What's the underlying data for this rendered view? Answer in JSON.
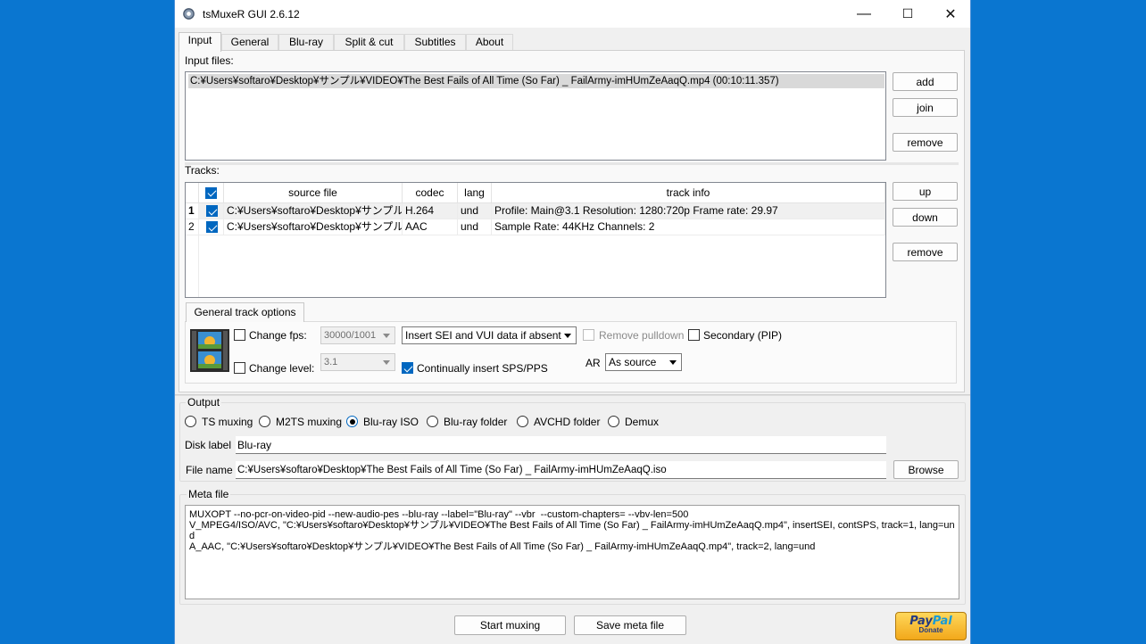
{
  "window": {
    "title": "tsMuxeR GUI 2.6.12",
    "minimize": "—",
    "maximize": "☐",
    "close": "✕"
  },
  "tabs": [
    "Input",
    "General",
    "Blu-ray",
    "Split & cut",
    "Subtitles",
    "About"
  ],
  "input": {
    "files_label": "Input files:",
    "files": [
      "C:¥Users¥softaro¥Desktop¥サンプル¥VIDEO¥The Best Fails of All Time (So Far) _ FailArmy-imHUmZeAaqQ.mp4 (00:10:11.357)"
    ],
    "add": "add",
    "join": "join",
    "remove": "remove"
  },
  "tracks": {
    "label": "Tracks:",
    "headers": {
      "source": "source file",
      "codec": "codec",
      "lang": "lang",
      "info": "track info"
    },
    "rows": [
      {
        "num": "1",
        "source": "C:¥Users¥softaro¥Desktop¥サンプル¥...",
        "codec": "H.264",
        "lang": "und",
        "info": "Profile: Main@3.1  Resolution: 1280:720p  Frame rate: 29.97"
      },
      {
        "num": "2",
        "source": "C:¥Users¥softaro¥Desktop¥サンプル¥...",
        "codec": "AAC",
        "lang": "und",
        "info": "Sample Rate: 44KHz  Channels: 2"
      }
    ],
    "up": "up",
    "down": "down",
    "remove": "remove"
  },
  "track_options": {
    "tab": "General track options",
    "change_fps": "Change fps:",
    "fps_value": "30000/1001",
    "sei_option": "Insert SEI and VUI data if absent",
    "remove_pulldown": "Remove pulldown",
    "secondary": "Secondary (PIP)",
    "change_level": "Change level:",
    "level_value": "3.1",
    "continually": "Continually insert SPS/PPS",
    "ar_label": "AR",
    "ar_value": "As source"
  },
  "output": {
    "label": "Output",
    "options": [
      "TS muxing",
      "M2TS muxing",
      "Blu-ray ISO",
      "Blu-ray folder",
      "AVCHD folder",
      "Demux"
    ],
    "selected": "Blu-ray ISO",
    "disk_label": "Disk label",
    "disk_value": "Blu-ray",
    "file_label": "File name",
    "file_value": "C:¥Users¥softaro¥Desktop¥The Best Fails of All Time (So Far) _ FailArmy-imHUmZeAaqQ.iso",
    "browse": "Browse"
  },
  "meta": {
    "label": "Meta file",
    "content": "MUXOPT --no-pcr-on-video-pid --new-audio-pes --blu-ray --label=\"Blu-ray\" --vbr  --custom-chapters= --vbv-len=500\nV_MPEG4/ISO/AVC, \"C:¥Users¥softaro¥Desktop¥サンプル¥VIDEO¥The Best Fails of All Time (So Far) _ FailArmy-imHUmZeAaqQ.mp4\", insertSEI, contSPS, track=1, lang=und\nA_AAC, \"C:¥Users¥softaro¥Desktop¥サンプル¥VIDEO¥The Best Fails of All Time (So Far) _ FailArmy-imHUmZeAaqQ.mp4\", track=2, lang=und"
  },
  "bottom": {
    "start": "Start muxing",
    "save": "Save meta file",
    "paypal_pay": "Pay",
    "paypal_pal": "Pal",
    "paypal_donate": "Donate"
  }
}
